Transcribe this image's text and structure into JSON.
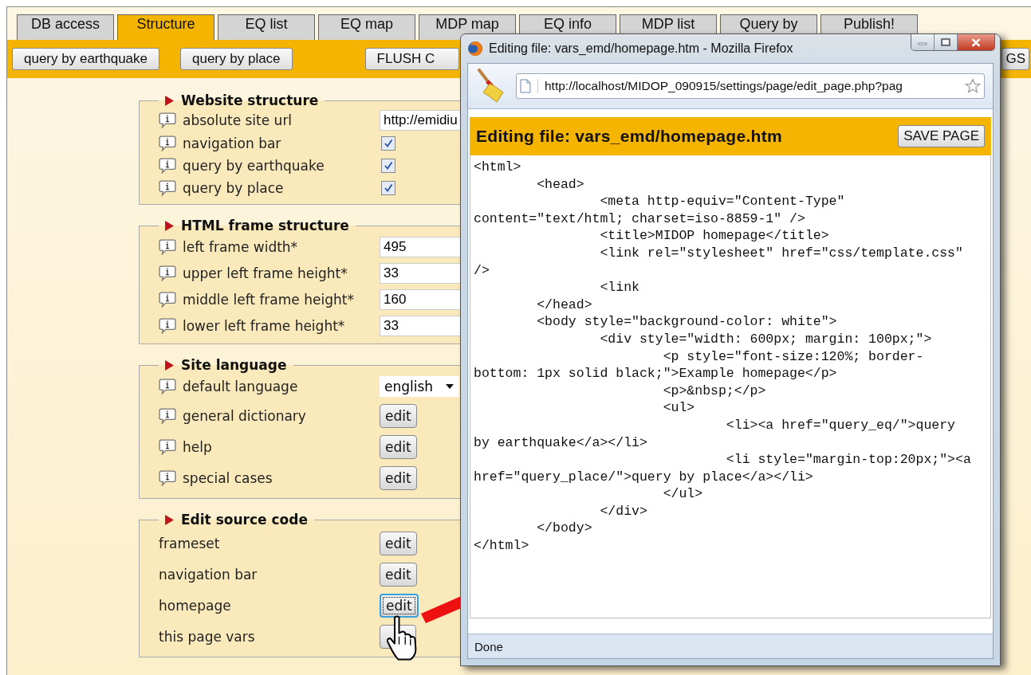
{
  "tabs": [
    {
      "label": "DB access",
      "selected": false
    },
    {
      "label": "Structure",
      "selected": true
    },
    {
      "label": "EQ list",
      "selected": false
    },
    {
      "label": "EQ map",
      "selected": false
    },
    {
      "label": "MDP map",
      "selected": false
    },
    {
      "label": "EQ info",
      "selected": false
    },
    {
      "label": "MDP list",
      "selected": false
    },
    {
      "label": "Query by",
      "selected": false
    },
    {
      "label": "Publish!",
      "selected": false
    }
  ],
  "toolbar": {
    "buttons": [
      "query by earthquake",
      "query by place",
      "FLUSH C"
    ],
    "right_button": "GS"
  },
  "sections": [
    {
      "title": "Website structure",
      "rows": [
        {
          "kind": "text",
          "label": "absolute site url",
          "info": true,
          "value": "http://emidiu"
        },
        {
          "kind": "checkbox",
          "label": "navigation bar",
          "info": true,
          "checked": true
        },
        {
          "kind": "checkbox",
          "label": "query by earthquake",
          "info": true,
          "checked": true
        },
        {
          "kind": "checkbox",
          "label": "query by place",
          "info": true,
          "checked": true
        }
      ]
    },
    {
      "title": "HTML frame structure",
      "rows": [
        {
          "kind": "text",
          "label": "left frame width*",
          "info": true,
          "value": "495"
        },
        {
          "kind": "text",
          "label": "upper left frame height*",
          "info": true,
          "value": "33"
        },
        {
          "kind": "text",
          "label": "middle left frame height*",
          "info": true,
          "value": "160"
        },
        {
          "kind": "text",
          "label": "lower left frame height*",
          "info": true,
          "value": "33"
        }
      ]
    },
    {
      "title": "Site language",
      "rows": [
        {
          "kind": "select",
          "label": "default language",
          "info": true,
          "value": "english"
        },
        {
          "kind": "button",
          "label": "general dictionary",
          "info": true,
          "button": "edit",
          "focused": false
        },
        {
          "kind": "button",
          "label": "help",
          "info": true,
          "button": "edit",
          "focused": false
        },
        {
          "kind": "button",
          "label": "special cases",
          "info": true,
          "button": "edit",
          "focused": false
        }
      ]
    },
    {
      "title": "Edit source code",
      "rows": [
        {
          "kind": "button",
          "label": "frameset",
          "info": false,
          "button": "edit",
          "focused": false
        },
        {
          "kind": "button",
          "label": "navigation bar",
          "info": false,
          "button": "edit",
          "focused": false
        },
        {
          "kind": "button",
          "label": "homepage",
          "info": false,
          "button": "edit",
          "focused": true
        },
        {
          "kind": "button",
          "label": "this page vars",
          "info": false,
          "focused": false
        }
      ]
    }
  ],
  "popup": {
    "title": "Editing file: vars_emd/homepage.htm - Mozilla Firefox",
    "url": "http://localhost/MIDOP_090915/settings/page/edit_page.php?pag",
    "heading": "Editing file: vars_emd/homepage.htm",
    "save_button": "SAVE PAGE",
    "code": "<html>\n\t<head>\n\t\t<meta http-equiv=\"Content-Type\" content=\"text/html; charset=iso-8859-1\" />\n\t\t<title>MIDOP homepage</title>\n\t\t<link rel=\"stylesheet\" href=\"css/template.css\" />\n\t\t<link\n\t</head>\n\t<body style=\"background-color: white\">\n\t\t<div style=\"width: 600px; margin: 100px;\">\n\t\t\t<p style=\"font-size:120%; border-bottom: 1px solid black;\">Example homepage</p>\n\t\t\t<p>&nbsp;</p>\n\t\t\t<ul>\n\t\t\t\t<li><a href=\"query_eq/\">query by earthquake</a></li>\n\t\t\t\t<li style=\"margin-top:20px;\"><a href=\"query_place/\">query by place</a></li>\n\t\t\t</ul>\n\t\t</div>\n\t</body>\n</html>",
    "status": "Done"
  }
}
